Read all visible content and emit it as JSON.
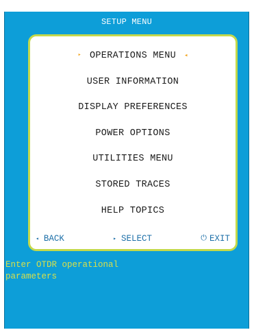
{
  "screen": {
    "title": "SETUP MENU"
  },
  "menu": {
    "items": [
      {
        "label": "OPERATIONS MENU"
      },
      {
        "label": "USER INFORMATION"
      },
      {
        "label": "DISPLAY PREFERENCES"
      },
      {
        "label": "POWER OPTIONS"
      },
      {
        "label": "UTILITIES MENU"
      },
      {
        "label": "STORED TRACES"
      },
      {
        "label": "HELP TOPICS"
      }
    ],
    "selected_index": 0,
    "selection_marker_left": "‣",
    "selection_marker_right": "◂"
  },
  "softkeys": {
    "back": {
      "label": "BACK",
      "icon": "left-triangle-icon",
      "glyph": "◂"
    },
    "select": {
      "label": "SELECT",
      "icon": "right-triangle-icon",
      "glyph": "▸"
    },
    "exit": {
      "label": "EXIT",
      "icon": "power-icon",
      "glyph": "⏻"
    }
  },
  "status": {
    "text": "Enter OTDR operational\nparameters"
  },
  "colors": {
    "screen_background": "#0d9ed8",
    "menu_border": "#c4d94a",
    "selection_arrow": "#f2a41c",
    "softkey_text": "#1c6fa8",
    "status_text": "#d8e04a",
    "title_text": "#ffffff"
  }
}
